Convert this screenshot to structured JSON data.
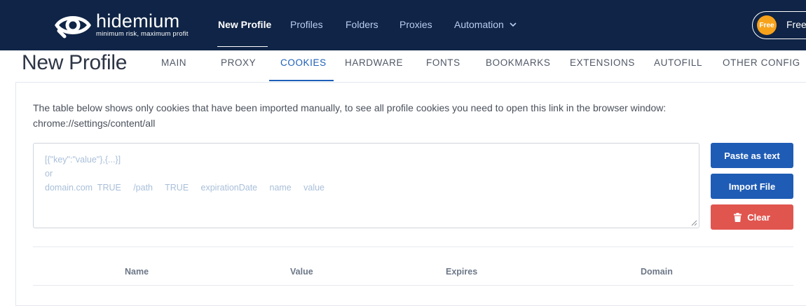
{
  "brand": {
    "name": "hidemium",
    "tagline": "minimum risk, maximum profit"
  },
  "nav": {
    "items": [
      {
        "label": "New Profile",
        "active": true
      },
      {
        "label": "Profiles"
      },
      {
        "label": "Folders"
      },
      {
        "label": "Proxies"
      }
    ],
    "automation_label": "Automation",
    "plan_badge": "Free",
    "plan_label": "Free"
  },
  "page": {
    "title": "New Profile",
    "tabs": [
      {
        "label": "MAIN"
      },
      {
        "label": "PROXY"
      },
      {
        "label": "COOKIES",
        "active": true
      },
      {
        "label": "HARDWARE"
      },
      {
        "label": "FONTS"
      },
      {
        "label": "BOOKMARKS"
      },
      {
        "label": "EXTENSIONS"
      },
      {
        "label": "AUTOFILL"
      },
      {
        "label": "OTHER CONFIG"
      }
    ]
  },
  "cookies": {
    "info_line1": "The table below shows only cookies that have been imported manually, to see all profile cookies you need to open this link in the browser window:",
    "info_line2": "chrome://settings/content/all",
    "placeholder_lines": [
      "[{\"key\":\"value\"},{...}]",
      "or",
      "domain.com  TRUE     /path     TRUE     expirationDate     name     value"
    ],
    "buttons": {
      "paste": "Paste as text",
      "import": "Import File",
      "clear": "Clear"
    },
    "table_headers": [
      "Name",
      "Value",
      "Expires",
      "Domain"
    ]
  },
  "colors": {
    "navbar": "#0f2446",
    "accent": "#1d5fb8",
    "button_blue": "#1f5cb5",
    "button_red": "#e1554f",
    "badge": "#f6a21b"
  }
}
